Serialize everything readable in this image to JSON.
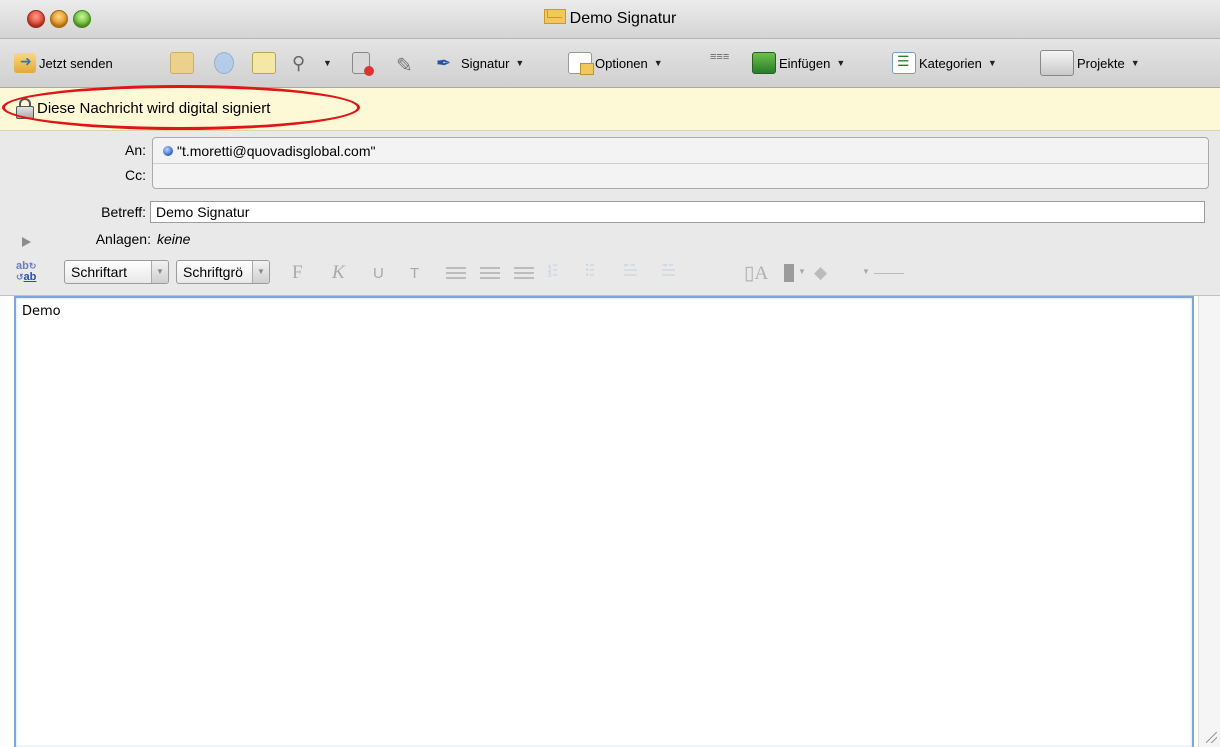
{
  "window": {
    "title": "Demo Signatur"
  },
  "toolbar": {
    "send_label": "Jetzt senden",
    "signature_label": "Signatur",
    "options_label": "Optionen",
    "insert_label": "Einfügen",
    "categories_label": "Kategorien",
    "projects_label": "Projekte"
  },
  "security": {
    "notice": "Diese Nachricht wird digital signiert"
  },
  "header_fields": {
    "to_label": "An:",
    "to_value": "\"t.moretti@quovadisglobal.com\"",
    "cc_label": "Cc:",
    "subject_label": "Betreff:",
    "subject_value": "Demo Signatur",
    "attachments_label": "Anlagen:",
    "attachments_value": "keine"
  },
  "format_toolbar": {
    "spell_top": "ab",
    "spell_bottom": "ab",
    "font_select": "Schriftart",
    "size_select": "Schriftgrö",
    "bold": "F",
    "italic": "K",
    "underline": "U",
    "strike": "T"
  },
  "message": {
    "body": "Demo"
  },
  "colors": {
    "highlight_ring": "#e01515",
    "notice_bg": "#fdf8d5"
  }
}
